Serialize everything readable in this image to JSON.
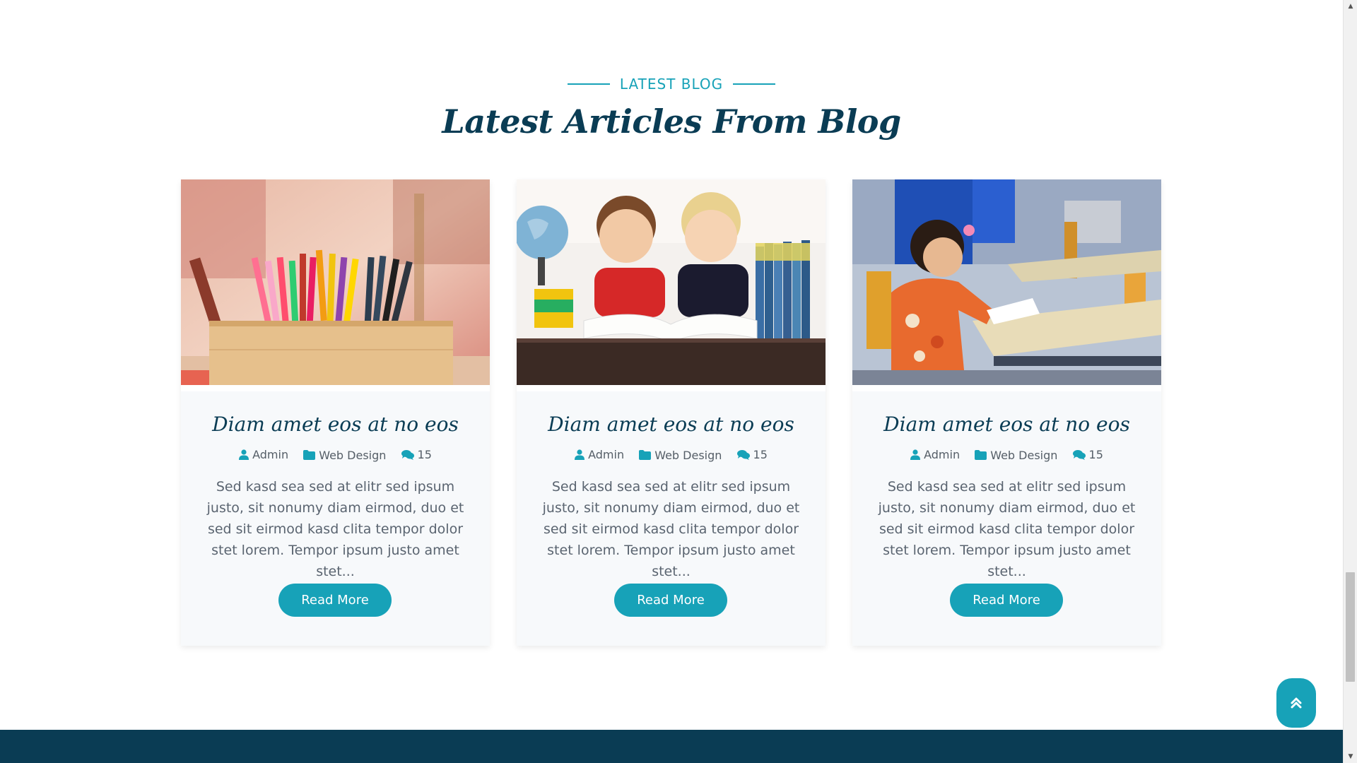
{
  "section": {
    "tag": "LATEST BLOG",
    "title": "Latest Articles From Blog"
  },
  "cards": [
    {
      "image": "colored-pencils-in-box",
      "title": "Diam amet eos at no eos",
      "author": "Admin",
      "category": "Web Design",
      "comments": "15",
      "excerpt": "Sed kasd sea sed at elitr sed ipsum justo, sit nonumy diam eirmod, duo et sed sit eirmod kasd clita tempor dolor stet lorem. Tempor ipsum justo amet stet...",
      "button": "Read More"
    },
    {
      "image": "two-boys-with-books",
      "title": "Diam amet eos at no eos",
      "author": "Admin",
      "category": "Web Design",
      "comments": "15",
      "excerpt": "Sed kasd sea sed at elitr sed ipsum justo, sit nonumy diam eirmod, duo et sed sit eirmod kasd clita tempor dolor stet lorem. Tempor ipsum justo amet stet...",
      "button": "Read More"
    },
    {
      "image": "girl-writing-at-desk",
      "title": "Diam amet eos at no eos",
      "author": "Admin",
      "category": "Web Design",
      "comments": "15",
      "excerpt": "Sed kasd sea sed at elitr sed ipsum justo, sit nonumy diam eirmod, duo et sed sit eirmod kasd clita tempor dolor stet lorem. Tempor ipsum justo amet stet...",
      "button": "Read More"
    }
  ],
  "icons": {
    "author": "user-icon",
    "category": "folder-icon",
    "comments": "comments-icon",
    "back_to_top": "angle-double-up-icon"
  },
  "colors": {
    "accent": "#17a2b8",
    "heading": "#0a3c54",
    "footer": "#0a3c54",
    "card_bg": "#f7f9fb"
  }
}
